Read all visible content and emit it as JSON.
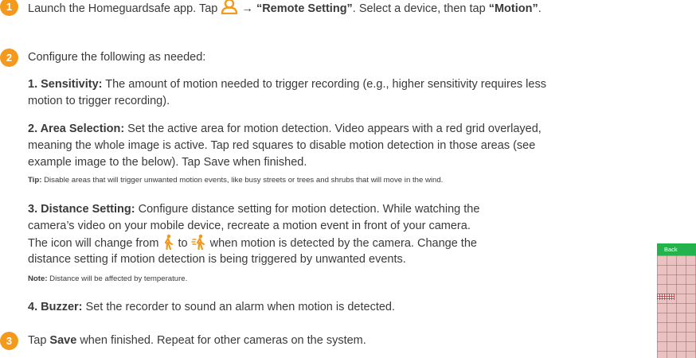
{
  "steps": [
    {
      "number": "1",
      "text_a": "Launch the Homeguardsafe app. Tap",
      "arrow": "→",
      "bold_a": "“Remote Setting”",
      "text_b": ". Select a device, then tap",
      "bold_b": "“Motion”",
      "text_c": ".",
      "icon": "user-icon"
    },
    {
      "number": "2",
      "intro": "Configure the following as needed:",
      "items": {
        "sensitivity": {
          "title": "1. Sensitivity:",
          "line1": " The amount of motion needed to trigger recording (e.g., higher sensitivity requires less",
          "line2": "motion to trigger recording)."
        },
        "area": {
          "title": "2. Area Selection:",
          "line1": " Set the active area for motion detection. Video appears with a red grid overlayed,",
          "line2": "meaning the whole image is active. Tap red squares to disable motion detection in those areas (see",
          "line3": "example image to the below). Tap Save when finished.",
          "tip_label": "Tip:",
          "tip_text": " Disable areas that will trigger unwanted motion events, like busy streets or trees and shrubs that will move in the wind."
        },
        "distance": {
          "title": "3. Distance Setting:",
          "line1": " Configure distance setting for motion detection. While watching the",
          "line2": "camera’s video on your mobile device, recreate a motion event in front of your camera.",
          "line3a": "The icon will change from",
          "line3b": "to",
          "line3c": "when motion is detected by the camera. Change the",
          "line4": "distance setting if motion detection is being triggered by unwanted events.",
          "note_label": "Note:",
          "note_text": " Distance will be affected by temperature.",
          "icon_idle": "walking-person-icon",
          "icon_active": "motion-person-icon"
        },
        "buzzer": {
          "title": "4. Buzzer:",
          "line1": " Set the recorder to sound an alarm when motion is detected."
        }
      }
    },
    {
      "number": "3",
      "text_a": "Tap",
      "bold_a": "Save",
      "text_b": " when finished. Repeat for other cameras on the system."
    }
  ],
  "phone_preview": {
    "back_label": "Back",
    "bar_color": "#23b24b",
    "grid_color": "#ebc2c2"
  },
  "colors": {
    "accent": "#f39a1d",
    "text": "#3a3a3a"
  }
}
